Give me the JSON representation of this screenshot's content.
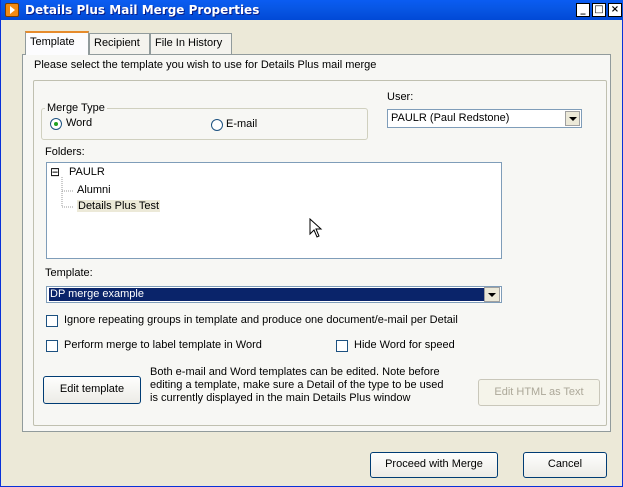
{
  "window": {
    "title": "Details Plus Mail Merge Properties"
  },
  "title_controls": {
    "minimize": "_",
    "maximize": "□",
    "close": "×"
  },
  "tabs": [
    "Template",
    "Recipient",
    "File In History"
  ],
  "instruction": "Please select the template you wish to use for Details Plus mail merge",
  "merge_type": {
    "label": "Merge Type",
    "options": [
      {
        "label": "Word",
        "checked": true
      },
      {
        "label": "E-mail",
        "checked": false
      }
    ]
  },
  "user": {
    "label": "User:",
    "value": "PAULR (Paul Redstone)"
  },
  "folders": {
    "label": "Folders:",
    "root": "PAULR",
    "expander": "⊟",
    "children": [
      "Alumni",
      "Details Plus Test"
    ]
  },
  "template": {
    "label": "Template:",
    "value": "DP merge example"
  },
  "options": {
    "ignore_repeating": "Ignore repeating groups in template and produce one document/e-mail per Detail",
    "label_template": "Perform merge to label template in Word",
    "hide_word": "Hide Word for speed"
  },
  "edit_template_button": "Edit template",
  "note": {
    "line1": "Both e-mail and Word  templates can be edited. Note before",
    "line2": "editing a template, make sure a Detail of the type to be used",
    "line3": "is currently displayed in the main Details Plus window"
  },
  "edit_html_button": "Edit HTML as Text",
  "footer": {
    "proceed": "Proceed with Merge",
    "cancel": "Cancel"
  },
  "colors": {
    "titlebar": "#0a5cf2",
    "selection": "#0a246a",
    "tab_accent": "#e68b2c"
  }
}
